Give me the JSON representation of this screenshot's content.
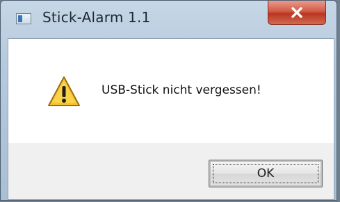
{
  "window": {
    "title": "Stick-Alarm 1.1",
    "close_icon": "close-icon",
    "app_icon": "application-icon"
  },
  "dialog": {
    "icon": "warning-icon",
    "message": "USB-Stick nicht vergessen!",
    "ok_label": "OK"
  },
  "colors": {
    "close_button": "#c9443a",
    "warning_fill": "#f2c332",
    "dialog_background": "#f0f0f0",
    "message_background": "#ffffff"
  }
}
